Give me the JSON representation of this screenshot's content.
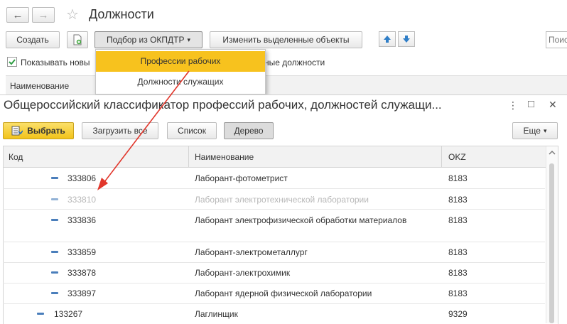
{
  "window": {
    "title": "Должности",
    "back_glyph": "←",
    "forward_glyph": "→",
    "star_glyph": "☆"
  },
  "toolbar": {
    "create_label": "Создать",
    "okpdtr_label": "Подбор из ОКПДТР",
    "edit_selected_label": "Изменить выделенные объекты",
    "search_placeholder": "Поис",
    "caret": "▾"
  },
  "checkbox": {
    "show_new_label": "Показывать новы",
    "tail_label": "ные должности"
  },
  "list_header": {
    "name_label": "Наименование"
  },
  "dropdown": {
    "items": [
      {
        "label": "Профессии рабочих",
        "selected": true
      },
      {
        "label": "Должности служащих",
        "selected": false
      }
    ]
  },
  "dialog": {
    "title": "Общероссийский классификатор профессий рабочих, должностей служащи...",
    "more_glyph": "⋮",
    "maximize_glyph": "□",
    "close_glyph": "✕",
    "select_label": "Выбрать",
    "load_all_label": "Загрузить все",
    "list_label": "Список",
    "tree_label": "Дерево",
    "more_label": "Еще"
  },
  "grid": {
    "columns": [
      "Код",
      "Наименование",
      "OKZ"
    ],
    "rows": [
      {
        "code": "333806",
        "name": "Лаборант-фотометрист",
        "okz": "8183",
        "muted": false
      },
      {
        "code": "333810",
        "name": "Лаборант электротехнической лаборатории",
        "okz": "8183",
        "muted": true
      },
      {
        "code": "333836",
        "name": "Лаборант электрофизической обработки материалов",
        "okz": "8183",
        "muted": false
      },
      {
        "code": "333859",
        "name": "Лаборант-электрометаллург",
        "okz": "8183",
        "muted": false
      },
      {
        "code": "333878",
        "name": "Лаборант-электрохимик",
        "okz": "8183",
        "muted": false
      },
      {
        "code": "333897",
        "name": "Лаборант ядерной физической лаборатории",
        "okz": "8183",
        "muted": false
      },
      {
        "code": "133267",
        "name": "Лаглинщик",
        "okz": "9329",
        "muted": false
      }
    ]
  },
  "colors": {
    "dropdown_highlight": "#f7c21e",
    "select_button": "#f5d12f",
    "arrow_red": "#e1362b",
    "tree_dash": "#4a7ebb"
  }
}
